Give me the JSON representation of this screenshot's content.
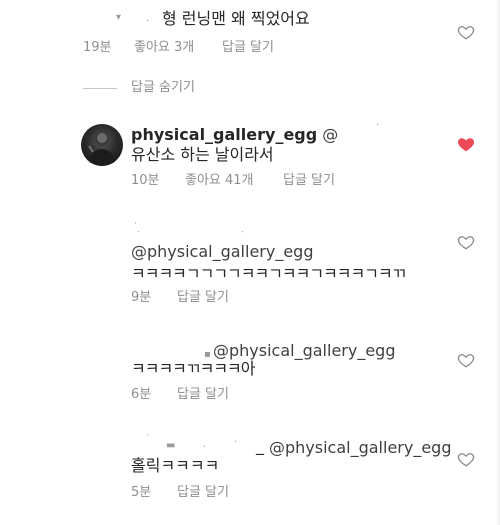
{
  "comments": [
    {
      "text": "형 런닝맨 왜 찍었어요",
      "time": "19분",
      "likes": "좋아요 3개",
      "reply": "답글 달기",
      "liked": false
    },
    {
      "hide_replies": "답글 숨기기"
    },
    {
      "username": "physical_gallery_egg",
      "mention": "@",
      "text": "유산소 하는 날이라서",
      "time": "10분",
      "likes": "좋아요 41개",
      "reply": "답글 달기",
      "liked": true
    },
    {
      "mention": "@physical_gallery_egg",
      "text": "ㅋㅋㅋㅋㄱㄱㄱㄱㅋㅋㄱㅋㅋㄱㅋㅋㅋㄱㅋㄲ",
      "time": "9분",
      "reply": "답글 달기",
      "liked": false
    },
    {
      "mention": "@physical_gallery_egg",
      "text": "ㅋㅋㅋㅋㄲㅋㅋㅋ아",
      "time": "6분",
      "reply": "답글 달기",
      "liked": false
    },
    {
      "mention": "@physical_gallery_egg",
      "text": "홀릭ㅋㅋㅋㅋ",
      "time": "5분",
      "reply": "답글 달기",
      "liked": false
    }
  ],
  "colors": {
    "like_red": "#ed4956",
    "meta_gray": "#8e8e8e",
    "text": "#262626"
  }
}
